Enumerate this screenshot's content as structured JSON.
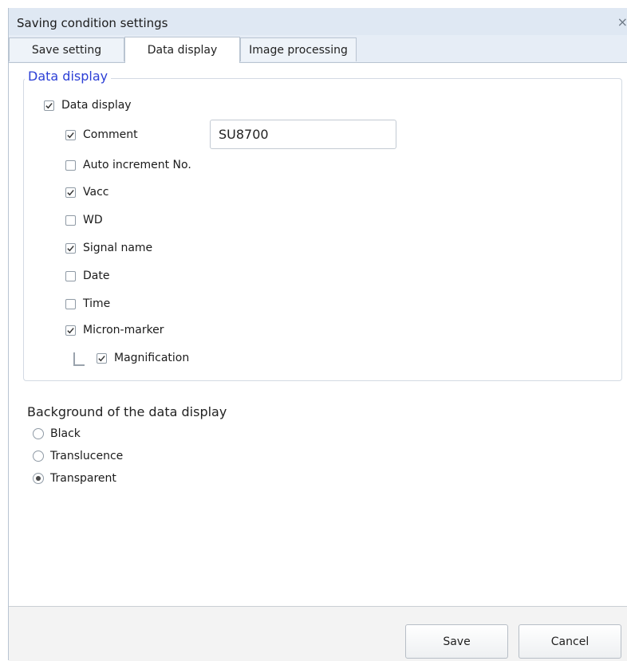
{
  "window": {
    "title": "Saving condition settings",
    "close_symbol": "×"
  },
  "tabs": [
    {
      "label": "Save setting",
      "active": false
    },
    {
      "label": "Data display",
      "active": true
    },
    {
      "label": "Image processing",
      "active": false
    }
  ],
  "data_display_group": {
    "legend": "Data display",
    "master": {
      "label": "Data display",
      "checked": true
    },
    "comment": {
      "label": "Comment",
      "checked": true,
      "value": "SU8700"
    },
    "items": [
      {
        "label": "Auto increment No.",
        "checked": false
      },
      {
        "label": "Vacc",
        "checked": true
      },
      {
        "label": "WD",
        "checked": false
      },
      {
        "label": "Signal name",
        "checked": true
      },
      {
        "label": "Date",
        "checked": false
      },
      {
        "label": "Time",
        "checked": false
      },
      {
        "label": "Micron-marker",
        "checked": true
      }
    ],
    "magnification": {
      "label": "Magnification",
      "checked": true
    }
  },
  "background": {
    "heading": "Background of the data display",
    "options": [
      {
        "label": "Black",
        "selected": false
      },
      {
        "label": "Translucence",
        "selected": false
      },
      {
        "label": "Transparent",
        "selected": true
      }
    ]
  },
  "footer": {
    "save_label": "Save",
    "cancel_label": "Cancel"
  },
  "colors": {
    "legend": "#2c3fd6",
    "title_bar": "#dfe8f3"
  }
}
